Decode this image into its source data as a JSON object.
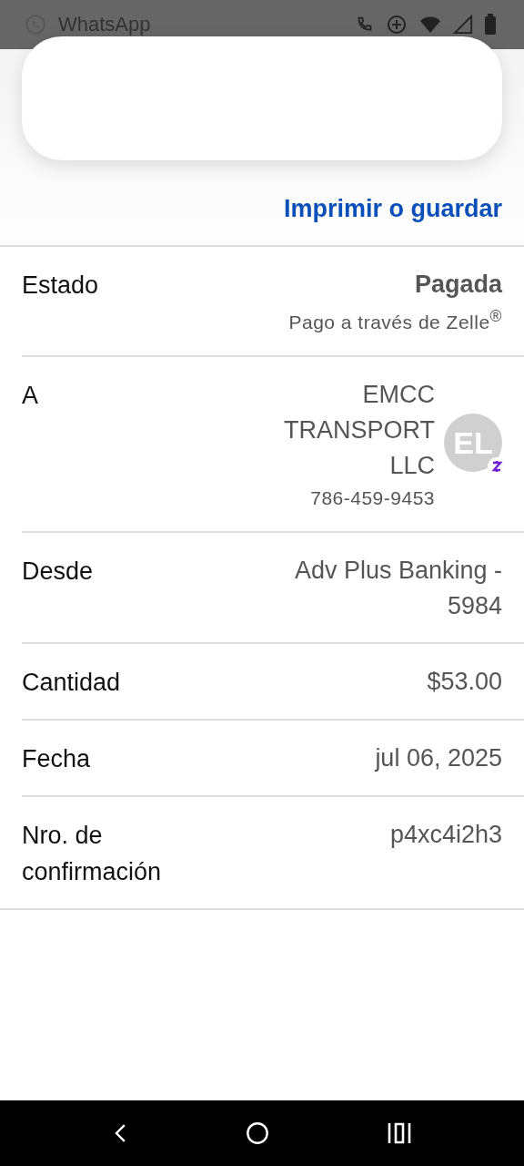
{
  "status_bar": {
    "app": "WhatsApp"
  },
  "print_link": "Imprimir o guardar",
  "rows": [
    {
      "kind": "status",
      "label": "Estado",
      "value": "Pagada",
      "sub": "Pago a través de Zelle$^{®}$"
    },
    {
      "kind": "contact",
      "label": "A",
      "value": "EMCC TRANSPORT LLC",
      "sub": "786-459-9453",
      "avatar": "EL"
    },
    {
      "kind": "plain",
      "label": "Desde",
      "value": "Adv Plus Banking - 5984"
    },
    {
      "kind": "plain",
      "label": "Cantidad",
      "value": "$53.00"
    },
    {
      "kind": "plain",
      "label": "Fecha",
      "value": "jul 06, 2025"
    },
    {
      "kind": "plain",
      "label": "Nro. de confirmación",
      "value": "p4xc4i2h3"
    }
  ]
}
